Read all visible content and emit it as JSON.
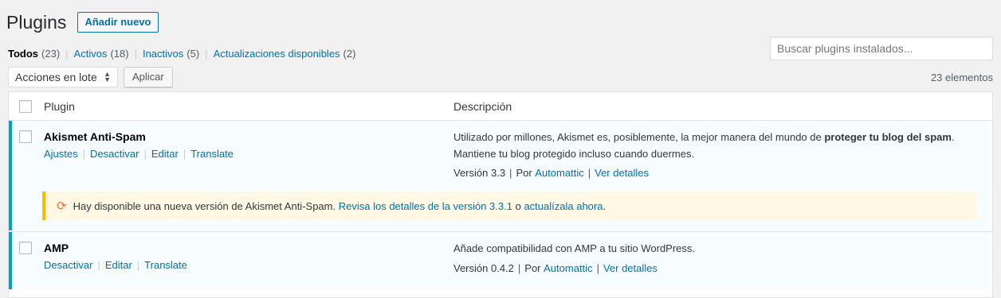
{
  "header": {
    "title": "Plugins",
    "add_new_label": "Añadir nuevo"
  },
  "filters": {
    "all_label": "Todos",
    "all_count": "(23)",
    "active_label": "Activos",
    "active_count": "(18)",
    "inactive_label": "Inactivos",
    "inactive_count": "(5)",
    "updates_label": "Actualizaciones disponibles",
    "updates_count": "(2)",
    "separator": "|"
  },
  "search": {
    "placeholder": "Buscar plugins instalados..."
  },
  "bulk": {
    "selected": "Acciones en lote",
    "apply_label": "Aplicar"
  },
  "items_count": "23 elementos",
  "table": {
    "col_plugin": "Plugin",
    "col_description": "Descripción",
    "rows": [
      {
        "name": "Akismet Anti-Spam",
        "actions": [
          "Ajustes",
          "Desactivar",
          "Editar",
          "Translate"
        ],
        "description_pre": "Utilizado por millones, Akismet es, posiblemente, la mejor manera del mundo de ",
        "description_bold": "proteger tu blog del spam",
        "description_post": ". Mantiene tu blog protegido incluso cuando duermes.",
        "version": "Versión 3.3",
        "by": "Por",
        "author": "Automattic",
        "details": "Ver detalles",
        "update": {
          "text": "Hay disponible una nueva versión de Akismet Anti-Spam.",
          "details_link": "Revisa los detalles de la versión 3.3.1",
          "or": "o",
          "update_link": "actualízala ahora",
          "end": "."
        }
      },
      {
        "name": "AMP",
        "actions": [
          "Desactivar",
          "Editar",
          "Translate"
        ],
        "description": "Añade compatibilidad con AMP a tu sitio WordPress.",
        "version": "Versión 0.4.2",
        "by": "Por",
        "author": "Automattic",
        "details": "Ver detalles"
      }
    ]
  },
  "colors": {
    "accent": "#0073aa",
    "active_bar": "#00a0d2",
    "notice_border": "#ffb900",
    "update_icon": "#f56e28"
  }
}
